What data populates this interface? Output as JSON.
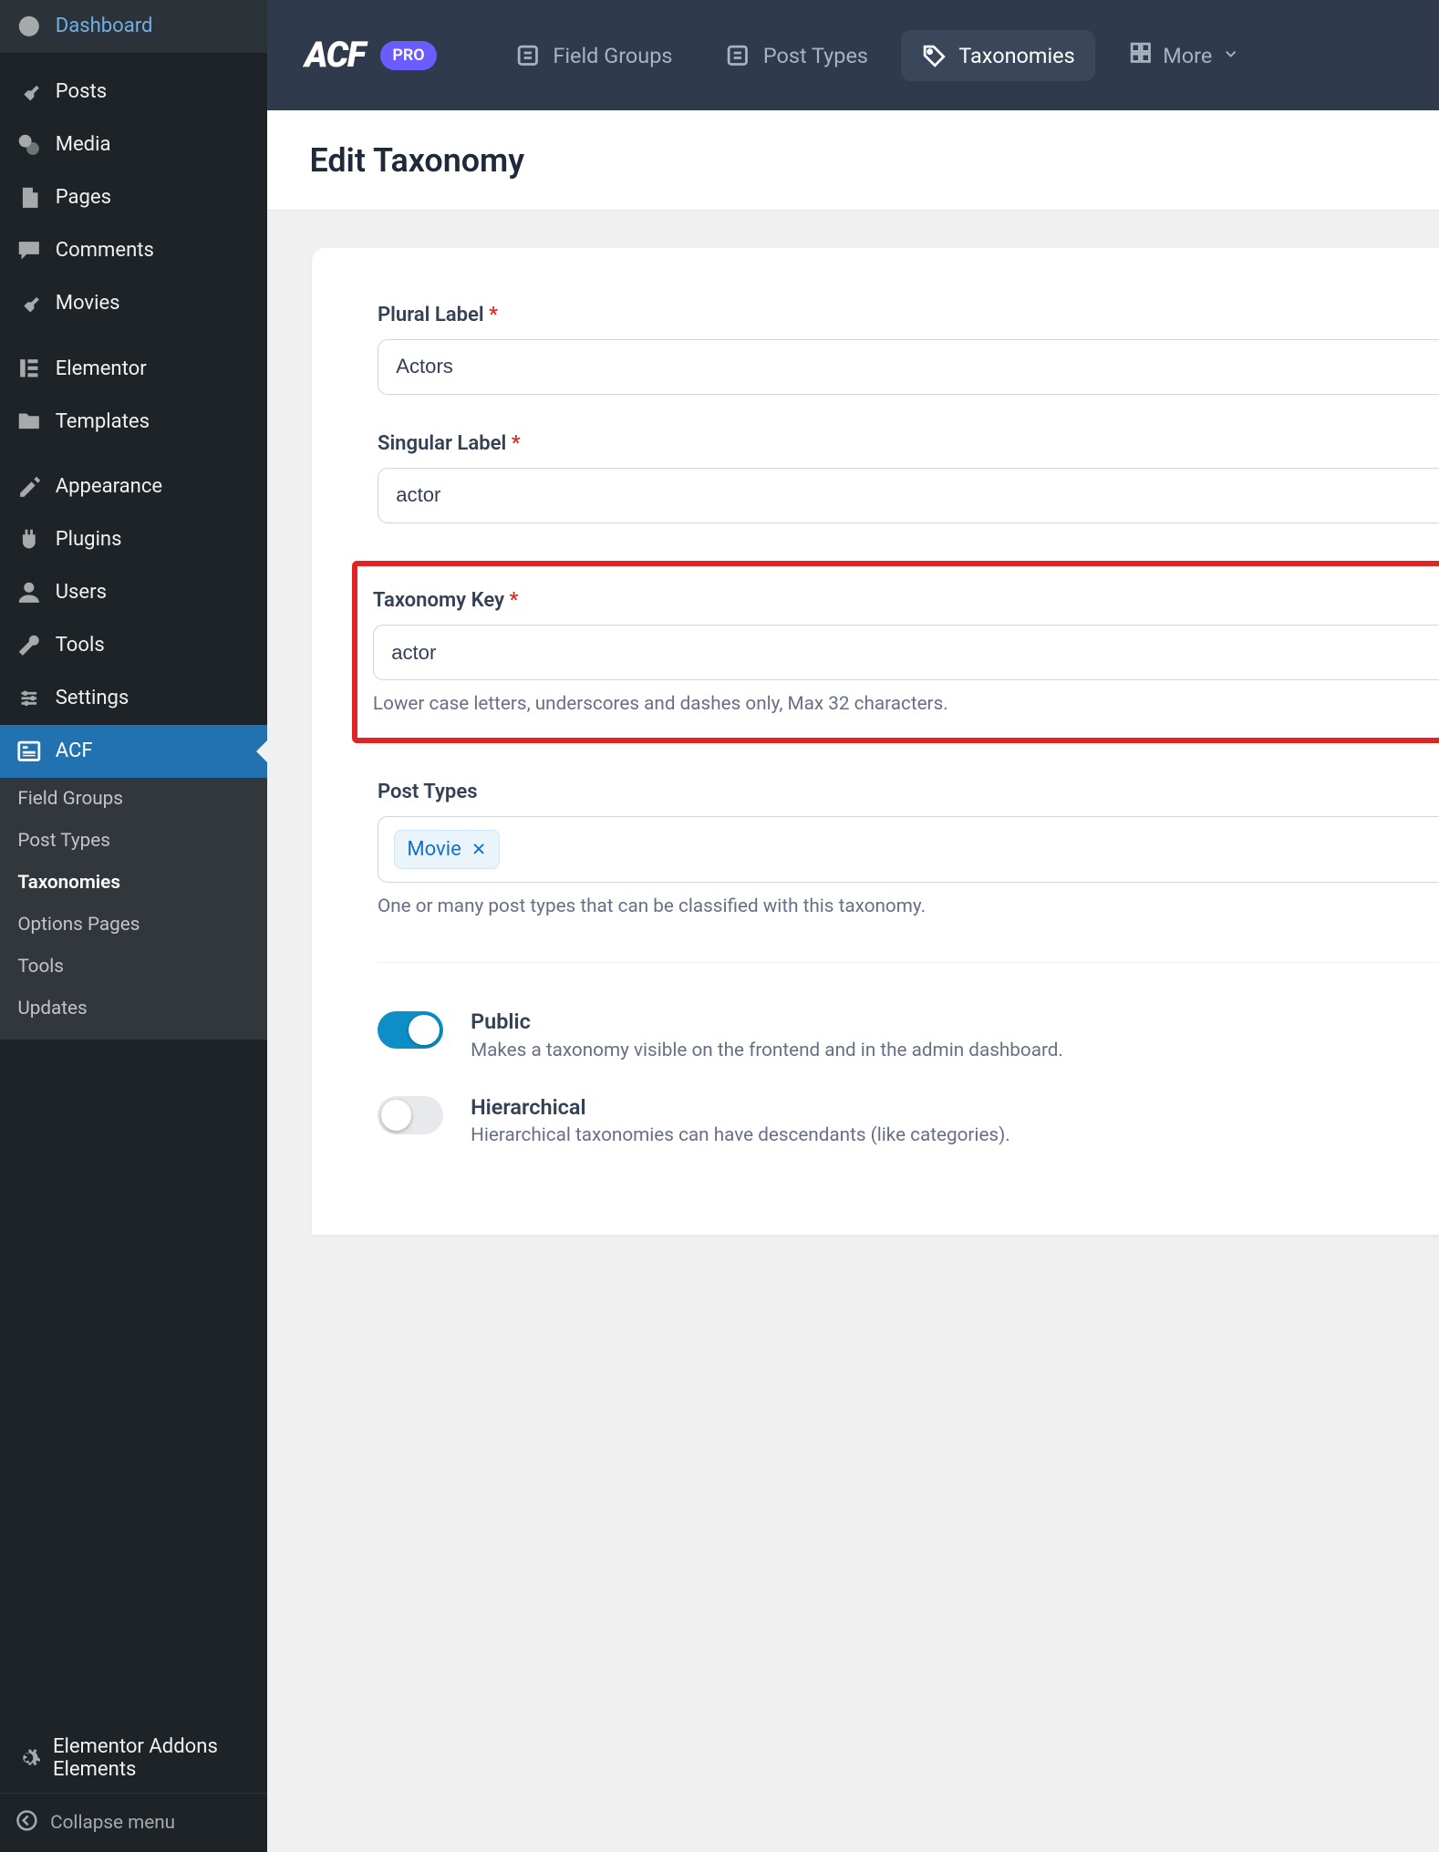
{
  "sidebar": {
    "items": [
      {
        "label": "Dashboard",
        "icon": "dashboard"
      },
      {
        "label": "Posts",
        "icon": "pin"
      },
      {
        "label": "Media",
        "icon": "media"
      },
      {
        "label": "Pages",
        "icon": "page"
      },
      {
        "label": "Comments",
        "icon": "comment"
      },
      {
        "label": "Movies",
        "icon": "pin"
      },
      {
        "label": "Elementor",
        "icon": "elementor"
      },
      {
        "label": "Templates",
        "icon": "folder"
      },
      {
        "label": "Appearance",
        "icon": "appearance"
      },
      {
        "label": "Plugins",
        "icon": "plugin"
      },
      {
        "label": "Users",
        "icon": "user"
      },
      {
        "label": "Tools",
        "icon": "tool"
      },
      {
        "label": "Settings",
        "icon": "settings"
      },
      {
        "label": "ACF",
        "icon": "acf"
      }
    ],
    "submenu": [
      "Field Groups",
      "Post Types",
      "Taxonomies",
      "Options Pages",
      "Tools",
      "Updates"
    ],
    "submenu_current": "Taxonomies",
    "extra": {
      "label": "Elementor Addons Elements",
      "icon": "gear"
    },
    "collapse": "Collapse menu"
  },
  "topbar": {
    "logo": "ACF",
    "badge": "PRO",
    "nav": [
      {
        "label": "Field Groups",
        "icon": "list"
      },
      {
        "label": "Post Types",
        "icon": "list"
      },
      {
        "label": "Taxonomies",
        "icon": "tag",
        "active": true
      }
    ],
    "more": "More"
  },
  "page": {
    "title": "Edit Taxonomy"
  },
  "form": {
    "plural": {
      "label": "Plural Label",
      "value": "Actors",
      "required": true
    },
    "singular": {
      "label": "Singular Label",
      "value": "actor",
      "required": true
    },
    "key": {
      "label": "Taxonomy Key",
      "value": "actor",
      "required": true,
      "help": "Lower case letters, underscores and dashes only, Max 32 characters."
    },
    "post_types": {
      "label": "Post Types",
      "tags": [
        "Movie"
      ],
      "help": "One or many post types that can be classified with this taxonomy."
    },
    "toggles": [
      {
        "title": "Public",
        "desc": "Makes a taxonomy visible on the frontend and in the admin dashboard.",
        "on": true
      },
      {
        "title": "Hierarchical",
        "desc": "Hierarchical taxonomies can have descendants (like categories).",
        "on": false
      }
    ]
  }
}
